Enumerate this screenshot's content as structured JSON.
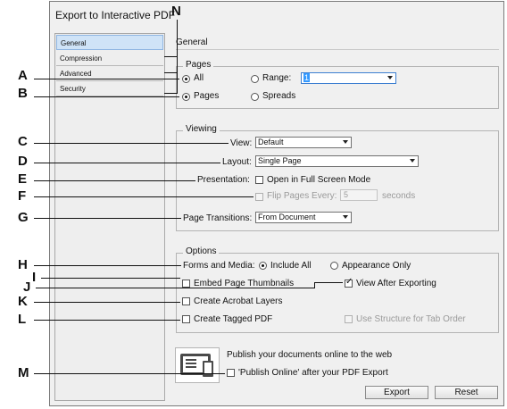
{
  "dialog": {
    "title": "Export to Interactive PDF",
    "section_heading": "General"
  },
  "sidebar": {
    "items": [
      {
        "label": "General"
      },
      {
        "label": "Compression"
      },
      {
        "label": "Advanced"
      },
      {
        "label": "Security"
      }
    ],
    "selected": "General"
  },
  "pages_group": {
    "legend": "Pages",
    "all_label": "All",
    "range_label": "Range:",
    "range_value": "1",
    "pages_label": "Pages",
    "spreads_label": "Spreads"
  },
  "viewing_group": {
    "legend": "Viewing",
    "view_label": "View:",
    "view_value": "Default",
    "layout_label": "Layout:",
    "layout_value": "Single Page",
    "presentation_label": "Presentation:",
    "full_screen_label": "Open in Full Screen Mode",
    "flip_label": "Flip Pages Every:",
    "flip_value": "5",
    "seconds_label": "seconds",
    "transitions_label": "Page Transitions:",
    "transitions_value": "From Document"
  },
  "options_group": {
    "legend": "Options",
    "forms_label": "Forms and Media:",
    "include_all_label": "Include All",
    "appearance_only_label": "Appearance Only",
    "embed_thumbnails_label": "Embed Page Thumbnails",
    "view_after_label": "View After Exporting",
    "acrobat_layers_label": "Create Acrobat Layers",
    "tagged_pdf_label": "Create Tagged PDF",
    "structure_tab_label": "Use Structure for Tab Order"
  },
  "publish": {
    "text": "Publish your documents online to the web",
    "checkbox_label": "'Publish Online' after your PDF Export"
  },
  "buttons": {
    "export": "Export",
    "reset": "Reset"
  },
  "annotations": {
    "A": "A",
    "B": "B",
    "C": "C",
    "D": "D",
    "E": "E",
    "F": "F",
    "G": "G",
    "H": "H",
    "I": "I",
    "J": "J",
    "K": "K",
    "L": "L",
    "M": "M",
    "N": "N"
  }
}
